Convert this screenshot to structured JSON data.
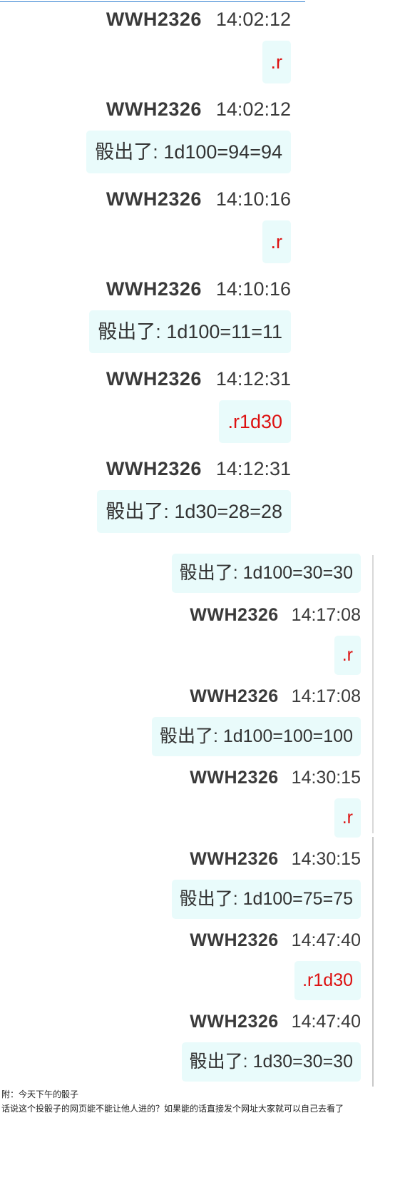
{
  "screenshot1": {
    "messages": [
      {
        "name": "WWH2326",
        "time": "14:02:12",
        "text": ".r",
        "kind": "command"
      },
      {
        "name": "WWH2326",
        "time": "14:02:12",
        "text": "骰出了: 1d100=94=94",
        "kind": "result"
      },
      {
        "name": "WWH2326",
        "time": "14:10:16",
        "text": ".r",
        "kind": "command"
      },
      {
        "name": "WWH2326",
        "time": "14:10:16",
        "text": "骰出了: 1d100=11=11",
        "kind": "result"
      },
      {
        "name": "WWH2326",
        "time": "14:12:31",
        "text": ".r1d30",
        "kind": "command"
      },
      {
        "name": "WWH2326",
        "time": "14:12:31",
        "text": "骰出了: 1d30=28=28",
        "kind": "result"
      }
    ]
  },
  "screenshot2": {
    "leading_bubble": "骰出了: 1d100=30=30",
    "messages": [
      {
        "name": "WWH2326",
        "time": "14:17:08",
        "text": ".r",
        "kind": "command"
      },
      {
        "name": "WWH2326",
        "time": "14:17:08",
        "text": "骰出了: 1d100=100=100",
        "kind": "result"
      },
      {
        "name": "WWH2326",
        "time": "14:30:15",
        "text": ".r",
        "kind": "command"
      },
      {
        "name": "WWH2326",
        "time": "14:30:15",
        "text": "骰出了: 1d100=75=75",
        "kind": "result"
      },
      {
        "name": "WWH2326",
        "time": "14:47:40",
        "text": ".r1d30",
        "kind": "command"
      },
      {
        "name": "WWH2326",
        "time": "14:47:40",
        "text": "骰出了: 1d30=30=30",
        "kind": "result"
      }
    ]
  },
  "footer": {
    "line1": "附：今天下午的骰子",
    "line2": "话说这个投骰子的网页能不能让他人进的？如果能的话直接发个网址大家就可以自己去看了"
  },
  "colors": {
    "command_text": "#dd1111",
    "result_text": "#333333",
    "bubble_bg": "#e9fbfb"
  }
}
